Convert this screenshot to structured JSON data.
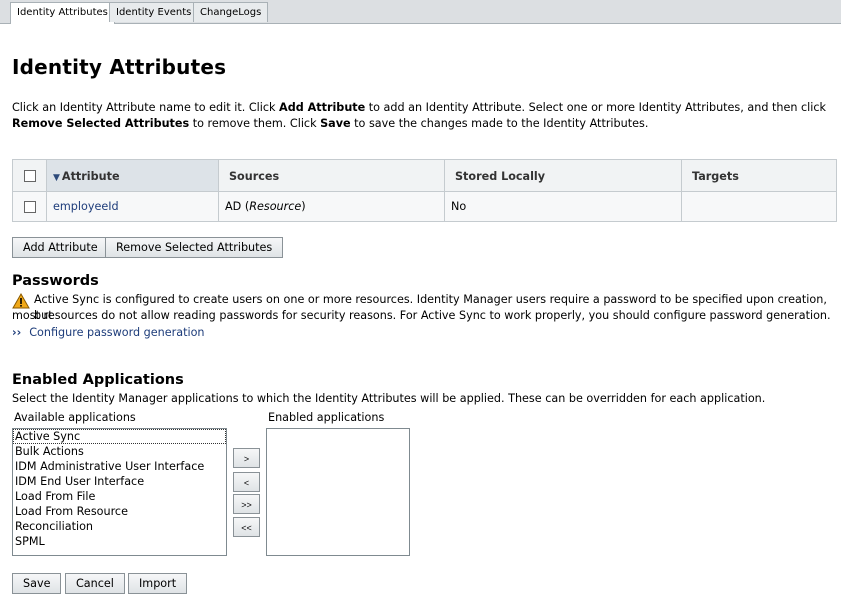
{
  "tabs": [
    "Identity Attributes",
    "Identity Events",
    "ChangeLogs"
  ],
  "page_title": "Identity Attributes",
  "intro": {
    "p1": "Click an Identity Attribute name to edit it. Click ",
    "b1": "Add Attribute",
    "p2": " to add an Identity Attribute. Select one or more Identity Attributes, and then click ",
    "b2": "Remove Selected Attributes",
    "p3": " to remove them. Click ",
    "b3": "Save",
    "p4": " to save the changes made to the Identity Attributes."
  },
  "table": {
    "headers": [
      "Attribute",
      "Sources",
      "Stored Locally",
      "Targets"
    ],
    "rows": [
      {
        "attribute": "employeeId",
        "source_name": "AD",
        "source_type": "Resource",
        "stored_locally": "No",
        "targets": ""
      }
    ]
  },
  "buttons": {
    "add_attribute": "Add Attribute",
    "remove_selected": "Remove Selected Attributes",
    "save": "Save",
    "cancel": "Cancel",
    "import": "Import"
  },
  "passwords": {
    "heading": "Passwords",
    "warning_line1": "Active Sync is configured to create users on one or more resources. Identity Manager users require a password to be specified upon creation, but",
    "warning_line2": "most resources do not allow reading passwords for security reasons. For Active Sync to work properly, you should configure password generation.",
    "link": "Configure password generation",
    "link_arrows": "››"
  },
  "enabled_apps": {
    "heading": "Enabled Applications",
    "description": "Select the Identity Manager applications to which the Identity Attributes will be applied. These can be overridden for each application.",
    "available_label": "Available applications",
    "enabled_label": "Enabled applications",
    "available": [
      "Active Sync",
      "Bulk Actions",
      "IDM Administrative User Interface",
      "IDM End User Interface",
      "Load From File",
      "Load From Resource",
      "Reconciliation",
      "SPML"
    ],
    "enabled": [],
    "move_buttons": [
      ">",
      "<",
      ">>",
      "<<"
    ]
  },
  "icons": {
    "warning": "warning-icon",
    "sort": "sort-desc-icon"
  },
  "colors": {
    "link": "#1d3c7a",
    "tab_bar": "#dcdfe2",
    "warning": "#f0a818"
  }
}
